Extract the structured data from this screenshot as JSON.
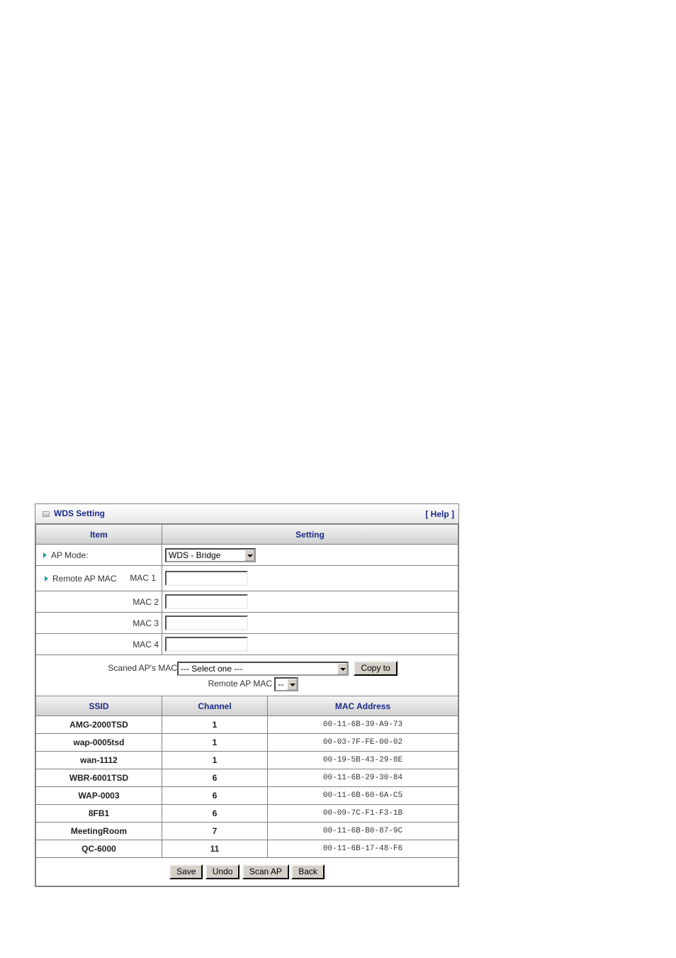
{
  "panel": {
    "title": "WDS Setting",
    "help_link": "[ Help ]",
    "title_icon": "box-icon"
  },
  "settings_header": {
    "item": "Item",
    "setting": "Setting"
  },
  "ap_mode": {
    "label": "AP Mode:",
    "selected": "WDS - Bridge"
  },
  "remote_ap_mac": {
    "label": "Remote AP MAC",
    "fields": [
      {
        "label": "MAC 1",
        "value": ""
      },
      {
        "label": "MAC 2",
        "value": ""
      },
      {
        "label": "MAC 3",
        "value": ""
      },
      {
        "label": "MAC 4",
        "value": ""
      }
    ]
  },
  "scan": {
    "scanned_label": "Scaned AP's MAC",
    "scanned_selected": "--- Select one ---",
    "copy_button": "Copy to",
    "remote_label": "Remote AP MAC",
    "remote_selected": "--"
  },
  "ap_table": {
    "headers": [
      "SSID",
      "Channel",
      "MAC Address"
    ],
    "rows": [
      {
        "ssid": "AMG-2000TSD",
        "channel": "1",
        "mac": "00-11-6B-39-A9-73"
      },
      {
        "ssid": "wap-0005tsd",
        "channel": "1",
        "mac": "00-03-7F-FE-00-02"
      },
      {
        "ssid": "wan-1112",
        "channel": "1",
        "mac": "00-19-5B-43-29-8E"
      },
      {
        "ssid": "WBR-6001TSD",
        "channel": "6",
        "mac": "00-11-6B-29-30-84"
      },
      {
        "ssid": "WAP-0003",
        "channel": "6",
        "mac": "00-11-6B-60-6A-C5"
      },
      {
        "ssid": "8FB1",
        "channel": "6",
        "mac": "00-09-7C-F1-F3-1B"
      },
      {
        "ssid": "MeetingRoom",
        "channel": "7",
        "mac": "00-11-6B-B0-87-9C"
      },
      {
        "ssid": "QC-6000",
        "channel": "11",
        "mac": "00-11-6B-17-48-F6"
      }
    ]
  },
  "actions": {
    "save": "Save",
    "undo": "Undo",
    "scan_ap": "Scan AP",
    "back": "Back"
  },
  "colors": {
    "header_text": "#1a2a8a",
    "arrow": "#20a0b0",
    "border": "#808080",
    "button_face": "#d4d0c8"
  }
}
